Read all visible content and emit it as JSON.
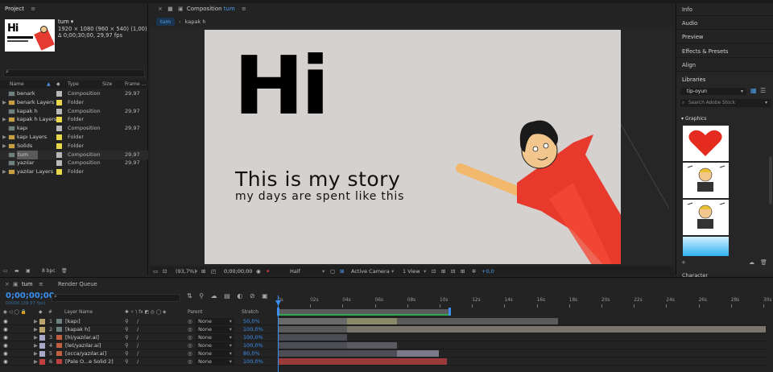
{
  "project": {
    "title": "Project",
    "comp_name": "tum ▾",
    "comp_size": "1920 × 1080  (960 × 540) (1,00)",
    "comp_duration": "Δ 0;00;30;00, 29,97 fps",
    "search_placeholder": "",
    "columns": {
      "name": "Name",
      "type": "Type",
      "size": "Size",
      "frame": "Frame ..."
    },
    "items": [
      {
        "name": "benark",
        "type": "Composition",
        "fps": "29,97",
        "kind": "comp",
        "color": "#b8b8b8"
      },
      {
        "name": "benark Layers",
        "type": "Folder",
        "fps": "",
        "kind": "folder",
        "color": "#e8d84a"
      },
      {
        "name": "kapak h",
        "type": "Composition",
        "fps": "29,97",
        "kind": "comp",
        "color": "#b8b8b8"
      },
      {
        "name": "kapak h Layers",
        "type": "Folder",
        "fps": "",
        "kind": "folder",
        "color": "#e8d84a"
      },
      {
        "name": "kapı",
        "type": "Composition",
        "fps": "29,97",
        "kind": "comp",
        "color": "#b8b8b8"
      },
      {
        "name": "kapı Layers",
        "type": "Folder",
        "fps": "",
        "kind": "folder",
        "color": "#e8d84a"
      },
      {
        "name": "Solids",
        "type": "Folder",
        "fps": "",
        "kind": "folder",
        "color": "#e8d84a"
      },
      {
        "name": "tum",
        "type": "Composition",
        "fps": "29,97",
        "kind": "comp",
        "color": "#b8b8b8"
      },
      {
        "name": "yazılar",
        "type": "Composition",
        "fps": "29,97",
        "kind": "comp",
        "color": "#b8b8b8"
      },
      {
        "name": "yazılar Layers",
        "type": "Folder",
        "fps": "",
        "kind": "folder",
        "color": "#e8d84a"
      }
    ],
    "bpc": "8 bpc"
  },
  "composition": {
    "tab_label": "Composition",
    "tab_comp": "tum",
    "crumb_active": "tum",
    "crumb_other": "kapak h",
    "canvas_big": "Hi",
    "canvas_line1": "This is my story",
    "canvas_line2": "my days are spent like this",
    "zoom": "(93,7%)",
    "timecode": "0;00;00;00",
    "resolution": "Half",
    "camera": "Active Camera",
    "view": "1 View",
    "exposure": "+0,0",
    "bg_color": "#d4d1cf"
  },
  "right_panel": {
    "items": [
      "Info",
      "Audio",
      "Preview",
      "Effects & Presets",
      "Align"
    ],
    "libraries_title": "Libraries",
    "library_name": "tip-oyun",
    "stock_search": "Search Adobe Stock",
    "graphics_label": "Graphics",
    "character_label": "Character"
  },
  "timeline": {
    "tab": "tum",
    "render_queue": "Render Queue",
    "timecode": "0;00;00;00",
    "fps_line": "00000 (29.97 fps)",
    "col_layer": "Layer Name",
    "col_parent": "Parent",
    "col_stretch": "Stretch",
    "ruler": [
      "0s",
      "02s",
      "04s",
      "06s",
      "08s",
      "10s",
      "12s",
      "14s",
      "16s",
      "18s",
      "20s",
      "22s",
      "24s",
      "26s",
      "28s",
      "30s"
    ],
    "layers": [
      {
        "num": "1",
        "name": "[kapı]",
        "parent": "None",
        "stretch": "50,0%",
        "label_color": "#b9a56b"
      },
      {
        "num": "2",
        "name": "[kapak h]",
        "parent": "None",
        "stretch": "100,0%",
        "label_color": "#b9a56b"
      },
      {
        "num": "3",
        "name": "[hi/yazılar.ai]",
        "parent": "None",
        "stretch": "100,0%",
        "label_color": "#a8a8c8"
      },
      {
        "num": "4",
        "name": "[let/yazılar.ai]",
        "parent": "None",
        "stretch": "100,0%",
        "label_color": "#a8a8c8"
      },
      {
        "num": "5",
        "name": "[occa/yazılar.ai]",
        "parent": "None",
        "stretch": "80,0%",
        "label_color": "#a8a8c8"
      },
      {
        "num": "6",
        "name": "[Pale O...e Solid 2]",
        "parent": "None",
        "stretch": "100,0%",
        "label_color": "#c04040"
      }
    ]
  }
}
